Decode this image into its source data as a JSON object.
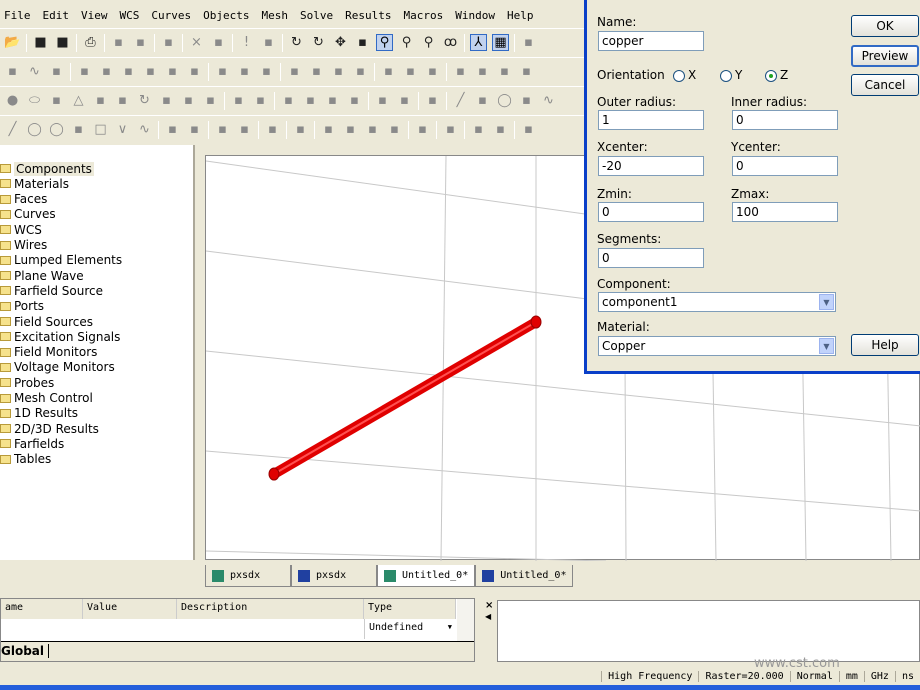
{
  "menu": [
    "File",
    "Edit",
    "View",
    "WCS",
    "Curves",
    "Objects",
    "Mesh",
    "Solve",
    "Results",
    "Macros",
    "Window",
    "Help"
  ],
  "toolbars": [
    [
      "open-icon",
      "|",
      "save-icon",
      "save-all-icon",
      "|",
      "print-icon",
      "|",
      "copy-icon",
      "cut-icon",
      "|",
      "paste-icon",
      "|",
      "delete-icon",
      "pick-icon",
      "|",
      "exclaim-icon",
      "history-icon",
      "|",
      "rotate-view-icon",
      "rotate-icon",
      "pan-icon",
      "dynamic-zoom-icon",
      "zoom-box-icon",
      "zoom-icon",
      "zoom-fit-icon",
      "glasses-icon",
      "|",
      "axes-icon",
      "grid-icon",
      "|",
      "copy-view-icon"
    ],
    [
      "picture-icon",
      "curve-icon",
      "box3d-icon",
      "|",
      "port-icon",
      "probe-icon",
      "plane-wave-icon",
      "lumped-icon",
      "farfield-icon",
      "discrete-port-icon",
      "|",
      "monitor-icon",
      "signal-icon",
      "settings-icon",
      "|",
      "solver-t-icon",
      "solver-f-icon",
      "solver-e-icon",
      "solver-i-icon",
      "|",
      "shape-icon",
      "shape2-icon",
      "shape3-icon",
      "|",
      "align-x-icon",
      "align-y-icon",
      "align-z-icon",
      "block-icon"
    ],
    [
      "sphere-icon",
      "cylinder-icon",
      "tube-icon",
      "cone-icon",
      "torus-icon",
      "extrude-icon",
      "rotate-shape-icon",
      "loft-icon",
      "bend-icon",
      "blend-icon",
      "|",
      "chamfer-icon",
      "shell-icon",
      "|",
      "boolean-add-icon",
      "boolean-sub-icon",
      "boolean-intersect-icon",
      "boolean-insert-icon",
      "|",
      "align-icon",
      "transform-icon",
      "|",
      "mesh-icon",
      "|",
      "line-icon",
      "polyline-icon",
      "circle-icon",
      "arc-icon",
      "spline-icon"
    ],
    [
      "line2-icon",
      "circle2-icon",
      "circle3-icon",
      "arc2-icon",
      "rectangle-icon",
      "polygon-icon",
      "spline2-icon",
      "|",
      "trace-icon",
      "coil-icon",
      "|",
      "pick-edge-icon",
      "pick-face-icon",
      "|",
      "cut2-icon",
      "|",
      "frame-icon",
      "|",
      "extrude-curve-icon",
      "sweep-icon",
      "loft2-icon",
      "layer-icon",
      "|",
      "wire-icon",
      "|",
      "wcs-local-icon",
      "|",
      "wcs-move-icon",
      "wcs-rotate-icon",
      "|",
      "wcs-align-icon"
    ]
  ],
  "tree": [
    "Components",
    "Materials",
    "Faces",
    "Curves",
    "WCS",
    "Wires",
    "Lumped Elements",
    "Plane Wave",
    "Farfield Source",
    "Ports",
    "Field Sources",
    "Excitation Signals",
    "Field Monitors",
    "Voltage Monitors",
    "Probes",
    "Mesh Control",
    "1D Results",
    "2D/3D Results",
    "Farfields",
    "Tables"
  ],
  "tabs": [
    "pxsdx",
    "pxsdx",
    "Untitled_0*",
    "Untitled_0*"
  ],
  "dialog": {
    "name_label": "Name:",
    "name": "copper",
    "orientation_label": "Orientation",
    "orient_x": "X",
    "orient_y": "Y",
    "orient_z": "Z",
    "orientation": "Z",
    "outer_radius_label": "Outer radius:",
    "outer_radius": "1",
    "inner_radius_label": "Inner radius:",
    "inner_radius": "0",
    "xcenter_label": "Xcenter:",
    "xcenter": "-20",
    "ycenter_label": "Ycenter:",
    "ycenter": "0",
    "zmin_label": "Zmin:",
    "zmin": "0",
    "zmax_label": "Zmax:",
    "zmax": "100",
    "segments_label": "Segments:",
    "segments": "0",
    "component_label": "Component:",
    "component": "component1",
    "material_label": "Material:",
    "material": "Copper",
    "ok": "OK",
    "preview": "Preview",
    "cancel": "Cancel",
    "help": "Help"
  },
  "params": {
    "headers": [
      "ame",
      "Value",
      "Description",
      "Type"
    ],
    "type_value": "Undefined",
    "tab": "Global"
  },
  "status": [
    "High Frequency",
    "Raster=20.000",
    "Normal",
    "mm",
    "GHz",
    "ns"
  ],
  "watermark": "www.cst.com",
  "colors": {
    "shape": "#e00000",
    "dialog_border": "#0a3fc8"
  }
}
